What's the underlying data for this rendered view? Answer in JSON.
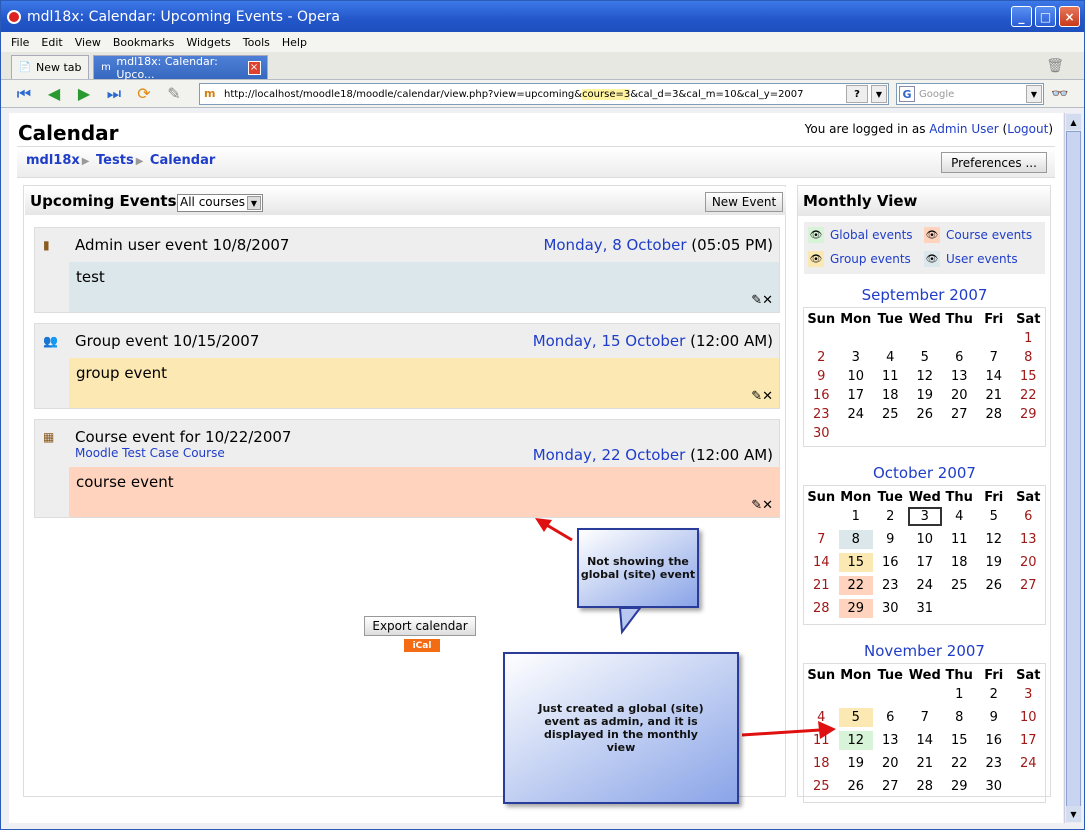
{
  "window": {
    "title": "mdl18x: Calendar: Upcoming Events - Opera"
  },
  "menu": [
    "File",
    "Edit",
    "View",
    "Bookmarks",
    "Widgets",
    "Tools",
    "Help"
  ],
  "tabs": {
    "new_tab": "New tab",
    "active": "mdl18x: Calendar: Upco..."
  },
  "address": {
    "pre": "http://localhost/moodle18/moodle/calendar/view.php?view=upcoming&",
    "hl": "course=3",
    "post": "&cal_d=3&cal_m=10&cal_y=2007",
    "help": "?"
  },
  "search": {
    "placeholder": "Google"
  },
  "page": {
    "title": "Calendar",
    "login_pre": "You are logged in as ",
    "login_user": "Admin User",
    "login_paren_open": " (",
    "login_logout": "Logout",
    "login_paren_close": ")",
    "crumbs": [
      "mdl18x",
      "Tests",
      "Calendar"
    ],
    "preferences": "Preferences ..."
  },
  "upcoming": {
    "title": "Upcoming Events:",
    "filter": "All courses",
    "new_event": "New Event",
    "events": [
      {
        "name": "Admin user event 10/8/2007",
        "date_link": "Monday, 8 October",
        "time": " (05:05 PM)",
        "sub": "",
        "desc": "test",
        "type": "user"
      },
      {
        "name": "Group event 10/15/2007",
        "date_link": "Monday, 15 October",
        "time": " (12:00 AM)",
        "sub": "",
        "desc": "group event",
        "type": "group"
      },
      {
        "name": "Course event for 10/22/2007",
        "date_link": "Monday, 22 October",
        "time": " (12:00 AM)",
        "sub": "Moodle Test Case Course",
        "desc": "course event",
        "type": "course"
      }
    ],
    "export": "Export calendar",
    "ical": "iCal"
  },
  "monthly": {
    "title": "Monthly View",
    "legend": [
      "Global events",
      "Course events",
      "Group events",
      "User events"
    ],
    "days": [
      "Sun",
      "Mon",
      "Tue",
      "Wed",
      "Thu",
      "Fri",
      "Sat"
    ],
    "months": [
      {
        "title": "September 2007",
        "start": 6,
        "len": 30,
        "marks": {}
      },
      {
        "title": "October 2007",
        "start": 1,
        "len": 31,
        "marks": {
          "8": "user",
          "15": "group",
          "22": "course",
          "29": "course"
        },
        "today": 3
      },
      {
        "title": "November 2007",
        "start": 4,
        "len": 30,
        "marks": {
          "5": "group",
          "12": "global"
        }
      }
    ]
  },
  "annotations": {
    "callout1": "Not showing the global (site) event",
    "callout2": "Just created a global (site) event as admin, and it is displayed in the monthly view"
  },
  "colors": {
    "global": "#d8f4d8",
    "course": "#ffd3bd",
    "group": "#fbe8b2",
    "user": "#dce7ec",
    "link": "#1f3dc8"
  }
}
